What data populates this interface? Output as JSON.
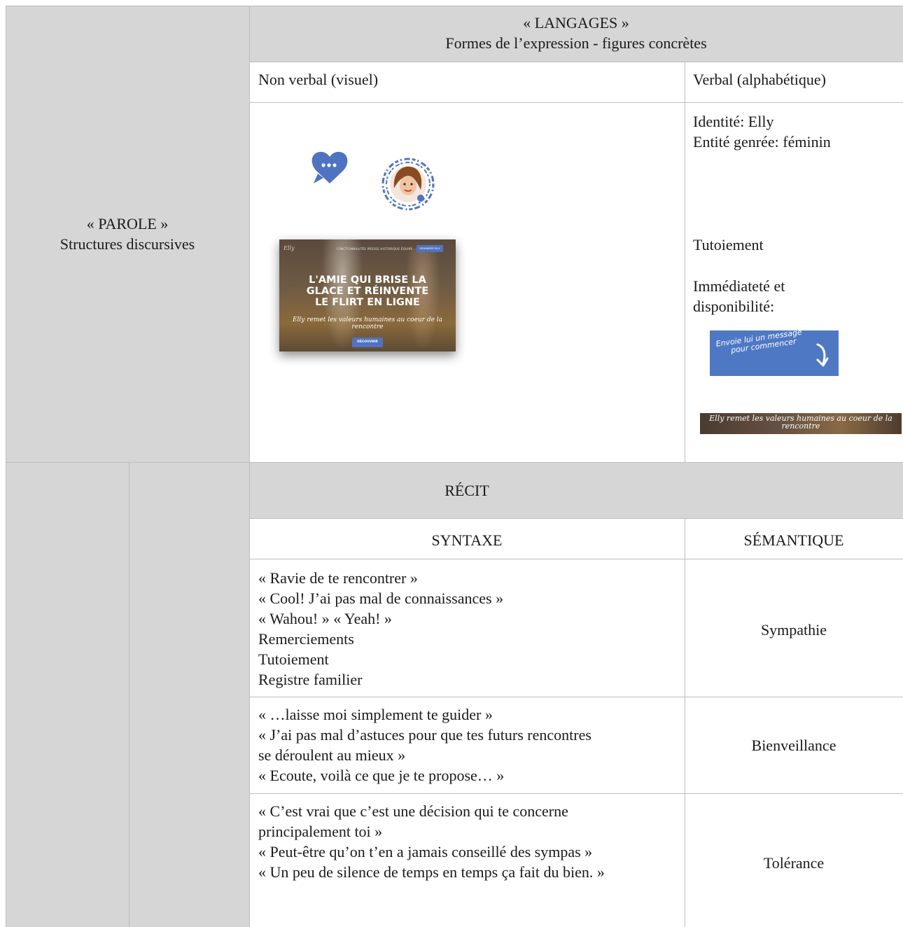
{
  "parole": {
    "line1": "« PAROLE »",
    "line2": "Structures discursives"
  },
  "langages": {
    "line1": "« LANGAGES »",
    "line2": "Formes de l’expression - figures concrètes",
    "col_visual": "Non verbal (visuel)",
    "col_verbal": "Verbal (alphabétique)"
  },
  "verbal": {
    "identity": "Identité: Elly",
    "gender": "Entité genrée: féminin",
    "tutoiement": "Tutoiement",
    "immediacy_1": "Immédiateté et",
    "immediacy_2": "disponibilité:"
  },
  "website": {
    "logo": "Elly",
    "nav": "FONCTIONNALITÉS   PRESSE   HISTORIQUE   ÉQUIPE",
    "nav_button": "DEMANDER ELLY",
    "headline_1": "L'AMIE QUI BRISE LA",
    "headline_2": "GLACE ET RÉINVENTE",
    "headline_3": "LE FLIRT EN LIGNE",
    "sub_1": "Elly remet les valeurs humaines au coeur de la",
    "sub_2": "rencontre",
    "cta": "DÉCOUVRIR"
  },
  "message_banner": {
    "line1": "Envoie lui un message",
    "line2": "pour commencer"
  },
  "strip": {
    "line1": "Elly remet les valeurs humaines au coeur de la",
    "line2": "rencontre"
  },
  "recit": {
    "title": "RÉCIT",
    "col_syntax": "SYNTAXE",
    "col_semantic": "SÉMANTIQUE",
    "rows": [
      {
        "lines": [
          "« Ravie de te rencontrer »",
          "« Cool! J’ai pas mal de connaissances »",
          "« Wahou! » « Yeah! »",
          "Remerciements",
          "Tutoiement",
          "Registre familier"
        ],
        "semantic": "Sympathie"
      },
      {
        "lines": [
          "« …laisse moi simplement te guider »",
          "« J’ai pas mal d’astuces pour que tes futurs rencontres",
          "se déroulent au mieux »",
          "« Ecoute, voilà ce que je te propose… »"
        ],
        "semantic": "Bienveillance"
      },
      {
        "lines": [
          "« C’est vrai que c’est une décision qui te concerne",
          "principalement toi »",
          "« Peut-être qu’on t’en a jamais conseillé des sympas »",
          "« Un peu de silence de temps en temps ça fait du bien. »"
        ],
        "semantic": "Tolérance"
      }
    ]
  },
  "colors": {
    "header_gray": "#d6d6d6",
    "border": "#bdbdbd",
    "accent_blue": "#4f73c0"
  },
  "icons": [
    "chat-heart-icon",
    "avatar-messenger-code-icon",
    "arrow-down-icon"
  ]
}
